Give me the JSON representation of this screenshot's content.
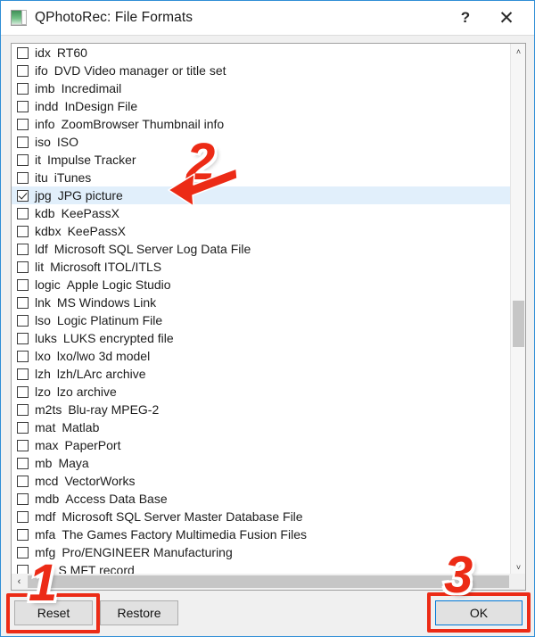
{
  "window": {
    "title": "QPhotoRec: File Formats",
    "icon": "app-icon",
    "help_label": "?",
    "close_label": "✕"
  },
  "file_formats": {
    "rows": [
      {
        "ext": "idx",
        "desc": "RT60",
        "checked": false,
        "selected": false
      },
      {
        "ext": "ifo",
        "desc": "DVD Video manager or title set",
        "checked": false,
        "selected": false
      },
      {
        "ext": "imb",
        "desc": "Incredimail",
        "checked": false,
        "selected": false
      },
      {
        "ext": "indd",
        "desc": "InDesign File",
        "checked": false,
        "selected": false
      },
      {
        "ext": "info",
        "desc": "ZoomBrowser Thumbnail info",
        "checked": false,
        "selected": false
      },
      {
        "ext": "iso",
        "desc": "ISO",
        "checked": false,
        "selected": false
      },
      {
        "ext": "it",
        "desc": "Impulse Tracker",
        "checked": false,
        "selected": false
      },
      {
        "ext": "itu",
        "desc": "iTunes",
        "checked": false,
        "selected": false
      },
      {
        "ext": "jpg",
        "desc": "JPG picture",
        "checked": true,
        "selected": true
      },
      {
        "ext": "kdb",
        "desc": "KeePassX",
        "checked": false,
        "selected": false
      },
      {
        "ext": "kdbx",
        "desc": "KeePassX",
        "checked": false,
        "selected": false
      },
      {
        "ext": "ldf",
        "desc": "Microsoft SQL Server Log Data File",
        "checked": false,
        "selected": false
      },
      {
        "ext": "lit",
        "desc": "Microsoft ITOL/ITLS",
        "checked": false,
        "selected": false
      },
      {
        "ext": "logic",
        "desc": "Apple Logic Studio",
        "checked": false,
        "selected": false
      },
      {
        "ext": "lnk",
        "desc": "MS Windows Link",
        "checked": false,
        "selected": false
      },
      {
        "ext": "lso",
        "desc": "Logic Platinum File",
        "checked": false,
        "selected": false
      },
      {
        "ext": "luks",
        "desc": "LUKS encrypted file",
        "checked": false,
        "selected": false
      },
      {
        "ext": "lxo",
        "desc": "lxo/lwo 3d model",
        "checked": false,
        "selected": false
      },
      {
        "ext": "lzh",
        "desc": "lzh/LArc archive",
        "checked": false,
        "selected": false
      },
      {
        "ext": "lzo",
        "desc": "lzo archive",
        "checked": false,
        "selected": false
      },
      {
        "ext": "m2ts",
        "desc": "Blu-ray MPEG-2",
        "checked": false,
        "selected": false
      },
      {
        "ext": "mat",
        "desc": "Matlab",
        "checked": false,
        "selected": false
      },
      {
        "ext": "max",
        "desc": "PaperPort",
        "checked": false,
        "selected": false
      },
      {
        "ext": "mb",
        "desc": "Maya",
        "checked": false,
        "selected": false
      },
      {
        "ext": "mcd",
        "desc": "VectorWorks",
        "checked": false,
        "selected": false
      },
      {
        "ext": "mdb",
        "desc": "Access Data Base",
        "checked": false,
        "selected": false
      },
      {
        "ext": "mdf",
        "desc": "Microsoft SQL Server Master Database File",
        "checked": false,
        "selected": false
      },
      {
        "ext": "mfa",
        "desc": "The Games Factory Multimedia Fusion Files",
        "checked": false,
        "selected": false
      },
      {
        "ext": "mfg",
        "desc": "Pro/ENGINEER Manufacturing",
        "checked": false,
        "selected": false
      },
      {
        "ext": "mft",
        "desc": "S MFT record",
        "checked": false,
        "selected": false
      }
    ]
  },
  "scrollbars": {
    "v_up_glyph": "˄",
    "v_down_glyph": "˅",
    "h_left_glyph": "‹",
    "h_right_glyph": "›"
  },
  "buttons": {
    "reset": "Reset",
    "restore": "Restore",
    "ok": "OK"
  },
  "annotations": {
    "step1": "1",
    "step2": "2",
    "step3": "3",
    "color": "#ec2b16"
  }
}
